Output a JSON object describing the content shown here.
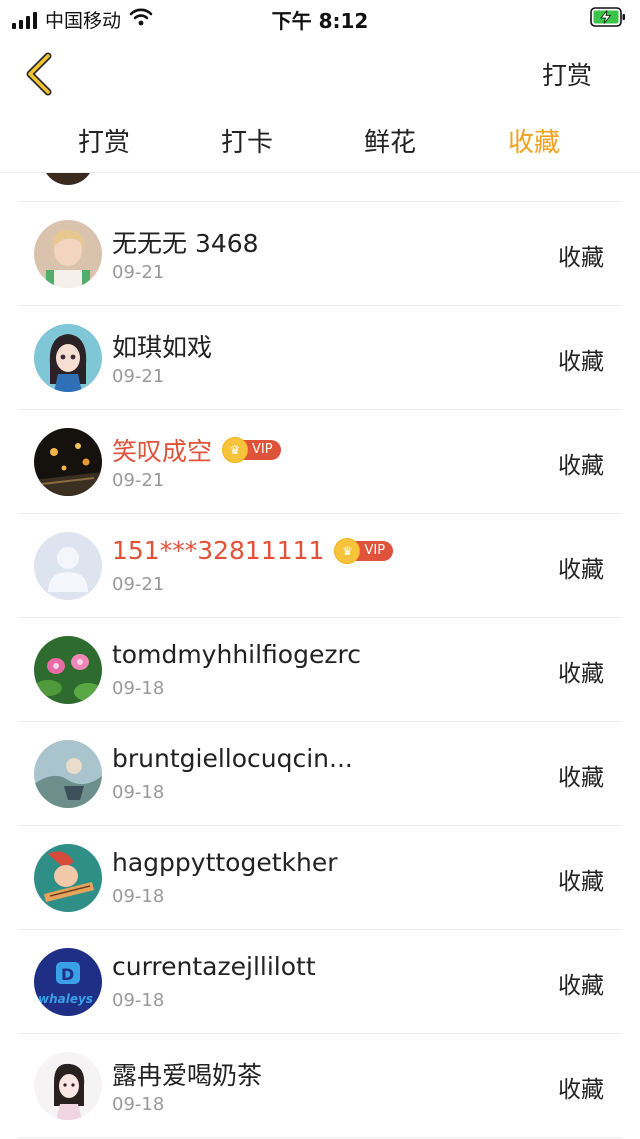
{
  "status_bar": {
    "carrier": "中国移动",
    "time": "下午 8:12",
    "icons": [
      "signal-icon",
      "wifi-icon",
      "battery-charging-icon"
    ]
  },
  "header": {
    "back_icon": "chevron-left-icon",
    "right_label": "打赏"
  },
  "tabs": [
    {
      "label": "打赏",
      "active": false
    },
    {
      "label": "打卡",
      "active": false
    },
    {
      "label": "鲜花",
      "active": false
    },
    {
      "label": "收藏",
      "active": true
    }
  ],
  "colors": {
    "accent": "#f0a21e",
    "vip_name": "#e0533b",
    "date": "#9a9a9a",
    "divider": "#ececec"
  },
  "items": [
    {
      "name": "无无无 3468",
      "date": "09-21",
      "vip": false,
      "action": "收藏"
    },
    {
      "name": "如琪如戏",
      "date": "09-21",
      "vip": false,
      "action": "收藏"
    },
    {
      "name": "笑叹成空",
      "date": "09-21",
      "vip": true,
      "vip_label": "VIP",
      "action": "收藏"
    },
    {
      "name": "151***32811111",
      "date": "09-21",
      "vip": true,
      "vip_label": "VIP",
      "action": "收藏"
    },
    {
      "name": "tomdmyhhilfiogezrc",
      "date": "09-18",
      "vip": false,
      "action": "收藏"
    },
    {
      "name": "bruntgiellocuqcin...",
      "date": "09-18",
      "vip": false,
      "action": "收藏"
    },
    {
      "name": "hagppyttogetkher",
      "date": "09-18",
      "vip": false,
      "action": "收藏"
    },
    {
      "name": "currentazejllilott",
      "date": "09-18",
      "vip": false,
      "action": "收藏",
      "avatar_text": "whaleys"
    },
    {
      "name": "露冉爱喝奶茶",
      "date": "09-18",
      "vip": false,
      "action": "收藏"
    }
  ]
}
